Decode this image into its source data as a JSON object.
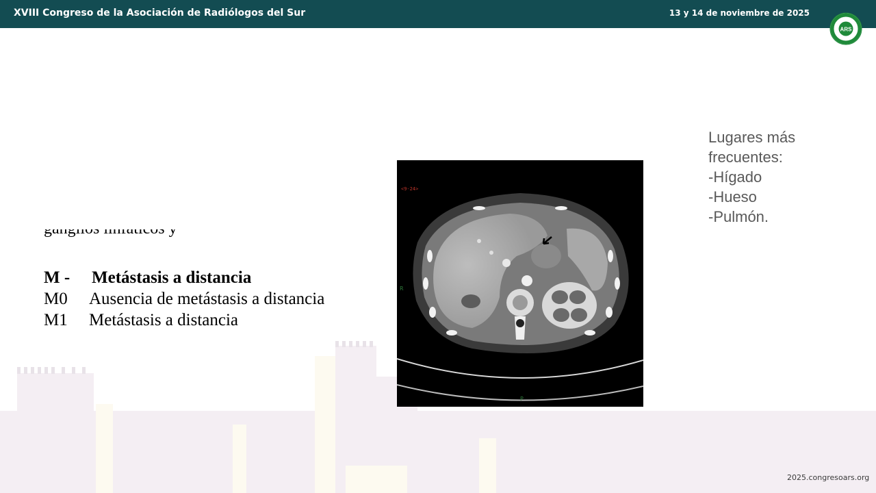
{
  "header": {
    "title": "XVIII Congreso de la Asociación de Radiólogos del Sur",
    "date": "13 y 14 de noviembre de 2025",
    "logo_center": "ARS",
    "logo_ring_text": "ASOCIACIÓN RADIÓLOGOS SUR"
  },
  "slide": {
    "cut_line_text": "ganglios linfáticos y",
    "metastasis_table": {
      "heading_code": "M -",
      "heading_desc": "Metástasis a distancia",
      "rows": [
        {
          "code": "M0",
          "desc": "Ausencia de metástasis a distancia"
        },
        {
          "code": "M1",
          "desc": "Metástasis a distancia"
        }
      ]
    },
    "ct_image": {
      "overlay_label": "<9-24>",
      "marker_r": "R",
      "marker_p": "P"
    },
    "side_note": {
      "lines": [
        "Lugares más",
        "frecuentes:",
        "-Hígado",
        "-Hueso",
        "-Pulmón."
      ]
    }
  },
  "footer": {
    "url": "2025.congresoars.org"
  },
  "colors": {
    "header_bg": "#134c52",
    "logo_green": "#1f8a3a",
    "side_note_text": "#595959"
  }
}
